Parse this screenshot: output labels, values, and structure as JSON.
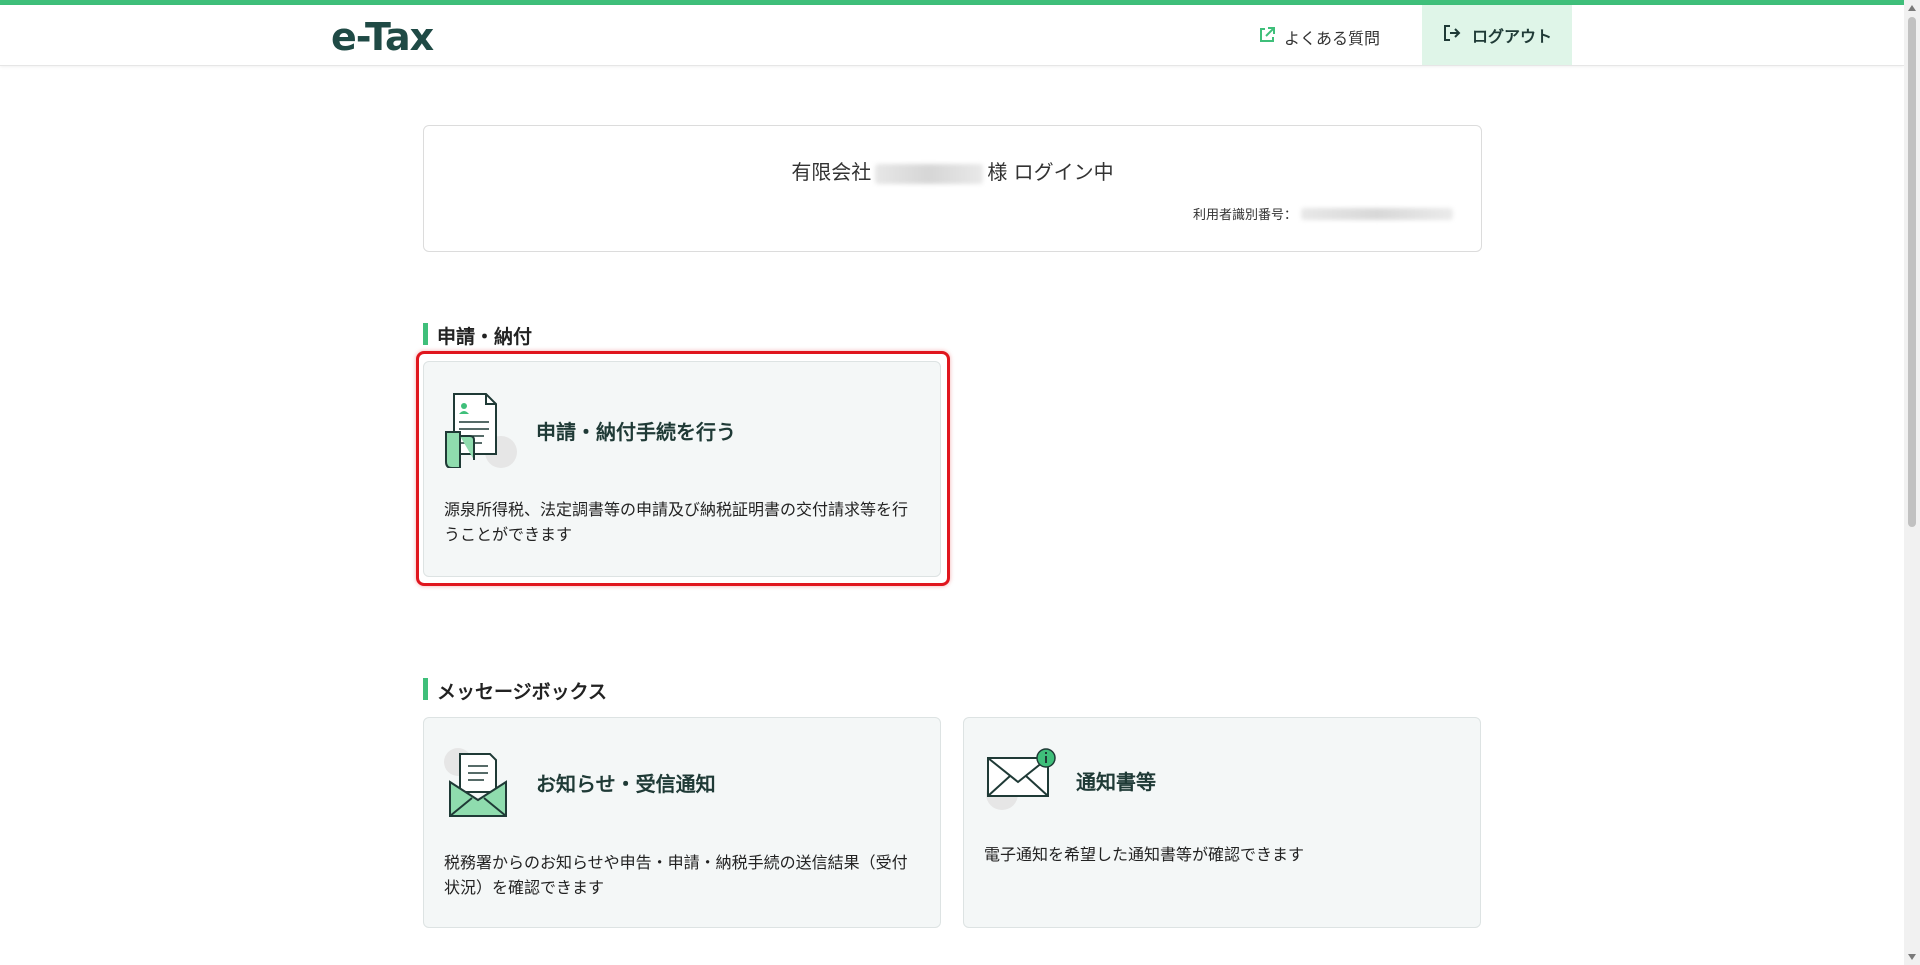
{
  "header": {
    "logo": "e-Tax",
    "faq_label": "よくある質問",
    "logout_label": "ログアウト"
  },
  "login_card": {
    "company_prefix": "有限会社",
    "status_suffix": "様 ログイン中",
    "user_id_label": "利用者識別番号："
  },
  "sections": {
    "apply": {
      "title": "申請・納付",
      "card": {
        "title": "申請・納付手続を行う",
        "desc": "源泉所得税、法定調書等の申請及び納税証明書の交付請求等を行うことができます"
      }
    },
    "messagebox": {
      "title": "メッセージボックス",
      "cards": [
        {
          "title": "お知らせ・受信通知",
          "desc": "税務署からのお知らせや申告・申請・納税手続の送信結果（受付状況）を確認できます"
        },
        {
          "title": "通知書等",
          "desc": "電子通知を希望した通知書等が確認できます"
        }
      ]
    }
  },
  "colors": {
    "accent": "#3fbf7a",
    "highlight": "#e0161e",
    "logout_bg": "#dff5e8"
  }
}
